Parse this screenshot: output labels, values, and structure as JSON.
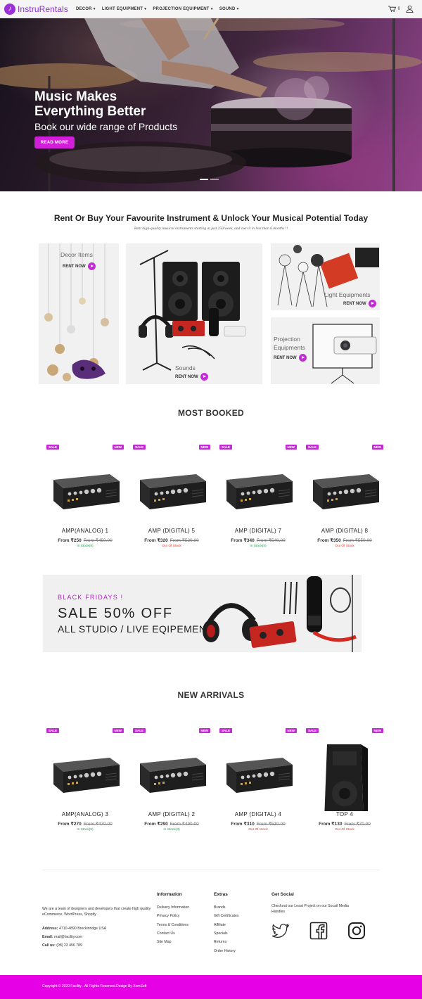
{
  "nav": {
    "brand": "InstruRentals",
    "menu": [
      {
        "label": "DECOR"
      },
      {
        "label": "LIGHT EQUIPMENT"
      },
      {
        "label": "PROJECTION EQUIPMENT"
      },
      {
        "label": "SOUND"
      }
    ],
    "cart_count": "0"
  },
  "hero": {
    "title_line1": "Music Makes",
    "title_line2": "Everything Better",
    "subtitle": "Book our wide range of Products",
    "button": "READ MORE"
  },
  "categories": {
    "title": "Rent Or Buy Your Favourite Instrument & Unlock Your Musical Potential Today",
    "subtitle": "Rent high-quality musical instruments starting at just 250/week, and own it in less than 6 months !!",
    "decor": {
      "label": "Decor Items",
      "cta": "RENT NOW"
    },
    "sounds": {
      "label": "Sounds",
      "cta": "RENT NOW"
    },
    "light": {
      "label": "Light Equipments",
      "cta": "RENT NOW"
    },
    "projection": {
      "label_line1": "Projection",
      "label_line2": "Equipments",
      "cta": "RENT NOW"
    }
  },
  "most_booked": {
    "title": "MOST BOOKED",
    "products": [
      {
        "sale": "SALE",
        "new": "NEW",
        "name": "AMP(ANALOG) 1",
        "price": "From ₹250",
        "old_price": "From ₹450.00",
        "stock": "In Stock(8)"
      },
      {
        "sale": "SALE",
        "new": "NEW",
        "name": "AMP (DIGITAL) 5",
        "price": "From ₹320",
        "old_price": "From ₹520.00",
        "stock": "Out Of Stock"
      },
      {
        "sale": "SALE",
        "new": "NEW",
        "name": "AMP (DIGITAL) 7",
        "price": "From ₹340",
        "old_price": "From ₹540.00",
        "stock": "In Stock(5)"
      },
      {
        "sale": "SALE",
        "new": "NEW",
        "name": "AMP (DIGITAL) 8",
        "price": "From ₹350",
        "old_price": "From ₹550.00",
        "stock": "Out Of Stock"
      }
    ]
  },
  "promo": {
    "kicker": "BLACK FRIDAYS !",
    "headline": "SALE 50% OFF",
    "subline": "ALL STUDIO / LIVE EQIPEMENT"
  },
  "new_arrivals": {
    "title": "NEW ARRIVALS",
    "products": [
      {
        "sale": "SALE",
        "new": "NEW",
        "name": "AMP(ANALOG) 3",
        "price": "From ₹270",
        "old_price": "From ₹470.00",
        "stock": "In Stock(5)"
      },
      {
        "sale": "SALE",
        "new": "NEW",
        "name": "AMP (DIGITAL) 2",
        "price": "From ₹290",
        "old_price": "From ₹490.00",
        "stock": "In Stock(4)"
      },
      {
        "sale": "SALE",
        "new": "NEW",
        "name": "AMP (DIGITAL) 4",
        "price": "From ₹310",
        "old_price": "From ₹510.00",
        "stock": "Out Of Stock"
      },
      {
        "sale": "SALE",
        "new": "NEW",
        "name": "TOP 4",
        "price": "From ₹130",
        "old_price": "From ₹70.00",
        "stock": "Out Of Stock"
      }
    ]
  },
  "footer": {
    "about": "We are a team of designers and developers that create high quality eCommerce, WordPress, Shopify .",
    "address_label": "Address:",
    "address": "4710-4890 Breckinridge USA",
    "email_label": "Email:",
    "email": "mail@facility.com",
    "call_label": "Call us:",
    "phone": "(08) 23 456 789",
    "information": {
      "title": "Information",
      "links": [
        "Delivery Information",
        "Privacy Policy",
        "Terms & Conditions",
        "Contact Us",
        "Site Map"
      ]
    },
    "extras": {
      "title": "Extras",
      "links": [
        "Brands",
        "Gift Certificates",
        "Affiliate",
        "Specials",
        "Returns",
        "Order History"
      ]
    },
    "social": {
      "title": "Get Social",
      "text": "Checkout our Least Project on our Socail Media Handles",
      "icons": [
        "twitter-icon",
        "facebook-icon",
        "instagram-icon"
      ]
    },
    "copyright": "Copyright © 2020 Facility . All Rights Reserved.Design By XemSoft"
  },
  "colors": {
    "accent": "#c42bd6",
    "bottom_bar": "#e600e6",
    "in_stock": "#1f9b4a",
    "out_of_stock": "#e0342f"
  }
}
